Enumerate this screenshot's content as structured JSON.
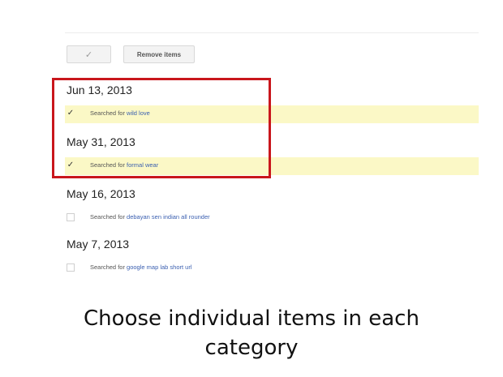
{
  "toolbar": {
    "check_glyph": "✓",
    "remove_label": "Remove items"
  },
  "groups": [
    {
      "date": "Jun 13, 2013",
      "item": {
        "selected": true,
        "prefix": "Searched for",
        "query": "wild love"
      }
    },
    {
      "date": "May 31, 2013",
      "item": {
        "selected": true,
        "prefix": "Searched for",
        "query": "formal wear"
      }
    },
    {
      "date": "May 16, 2013",
      "item": {
        "selected": false,
        "prefix": "Searched for",
        "query": "debayan sen indian all rounder"
      }
    },
    {
      "date": "May 7, 2013",
      "item": {
        "selected": false,
        "prefix": "Searched for",
        "query": "google map lab short url"
      }
    }
  ],
  "caption": {
    "line1": "Choose individual items in each",
    "line2": "category"
  },
  "colors": {
    "highlight_border": "#c9161c",
    "selected_row": "#fbf8c6",
    "link": "#3a5fb0"
  },
  "icons": {
    "check": "checkmark-icon"
  }
}
